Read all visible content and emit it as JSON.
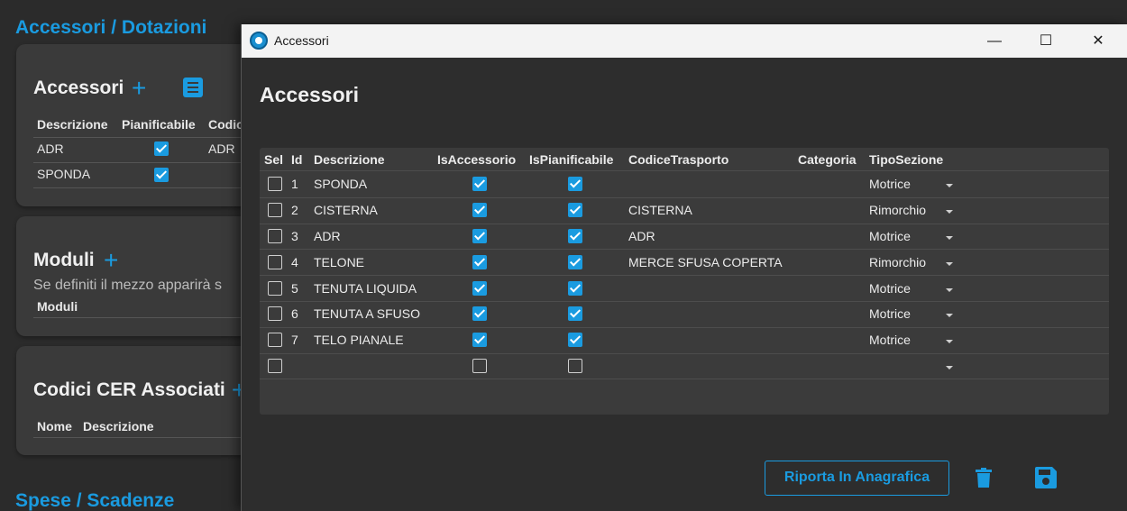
{
  "background": {
    "section_title": "Accessori / Dotazioni",
    "section_title2": "Spese / Scadenze",
    "accessori_card": {
      "title": "Accessori",
      "headers": [
        "Descrizione",
        "Pianificabile",
        "Codic"
      ],
      "rows": [
        {
          "descrizione": "ADR",
          "pianificabile": true,
          "codice": "ADR"
        },
        {
          "descrizione": "SPONDA",
          "pianificabile": true,
          "codice": ""
        }
      ]
    },
    "moduli_card": {
      "title": "Moduli",
      "note": "Se definiti il mezzo apparirà s",
      "header": "Moduli"
    },
    "cer_card": {
      "title": "Codici CER Associati",
      "headers": [
        "Nome",
        "Descrizione"
      ]
    }
  },
  "window": {
    "title": "Accessori",
    "minimize": "—",
    "maximize": "☐",
    "close": "✕"
  },
  "dialog": {
    "title": "Accessori",
    "columns": [
      "Sel",
      "Id",
      "Descrizione",
      "IsAccessorio",
      "IsPianificabile",
      "CodiceTrasporto",
      "Categoria",
      "TipoSezione"
    ],
    "rows": [
      {
        "sel": false,
        "id": "1",
        "descrizione": "SPONDA",
        "is_accessorio": true,
        "is_pianificabile": true,
        "codice_trasporto": "",
        "categoria": "",
        "tipo_sezione": "Motrice"
      },
      {
        "sel": false,
        "id": "2",
        "descrizione": "CISTERNA",
        "is_accessorio": true,
        "is_pianificabile": true,
        "codice_trasporto": "CISTERNA",
        "categoria": "",
        "tipo_sezione": "Rimorchio"
      },
      {
        "sel": false,
        "id": "3",
        "descrizione": "ADR",
        "is_accessorio": true,
        "is_pianificabile": true,
        "codice_trasporto": "ADR",
        "categoria": "",
        "tipo_sezione": "Motrice"
      },
      {
        "sel": false,
        "id": "4",
        "descrizione": "TELONE",
        "is_accessorio": true,
        "is_pianificabile": true,
        "codice_trasporto": "MERCE SFUSA COPERTA",
        "categoria": "",
        "tipo_sezione": "Rimorchio"
      },
      {
        "sel": false,
        "id": "5",
        "descrizione": "TENUTA LIQUIDA",
        "is_accessorio": true,
        "is_pianificabile": true,
        "codice_trasporto": "",
        "categoria": "",
        "tipo_sezione": "Motrice"
      },
      {
        "sel": false,
        "id": "6",
        "descrizione": "TENUTA A SFUSO",
        "is_accessorio": true,
        "is_pianificabile": true,
        "codice_trasporto": "",
        "categoria": "",
        "tipo_sezione": "Motrice"
      },
      {
        "sel": false,
        "id": "7",
        "descrizione": "TELO PIANALE",
        "is_accessorio": true,
        "is_pianificabile": true,
        "codice_trasporto": "",
        "categoria": "",
        "tipo_sezione": "Motrice"
      },
      {
        "sel": false,
        "id": "",
        "descrizione": "",
        "is_accessorio": false,
        "is_pianificabile": false,
        "codice_trasporto": "",
        "categoria": "",
        "tipo_sezione": ""
      }
    ],
    "riporta_button": "Riporta In Anagrafica",
    "accent_color": "#1a9be0"
  }
}
